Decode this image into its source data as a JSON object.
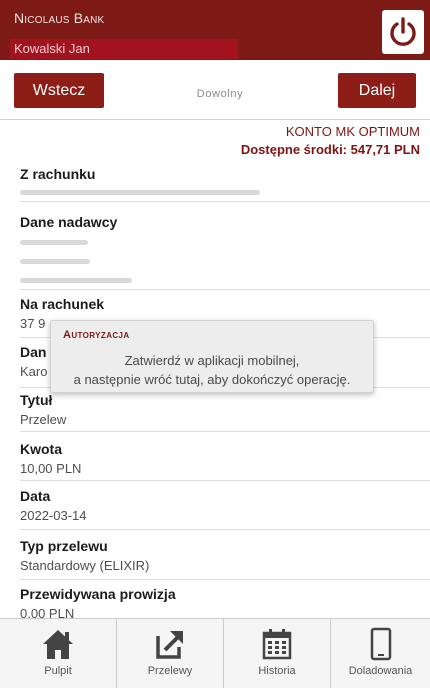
{
  "header": {
    "bank_name": "Nicolaus Bank",
    "user_name": "Kowalski Jan",
    "power_icon": "power-icon"
  },
  "nav": {
    "back_label": "Wstecz",
    "mode_title": "Dowolny",
    "next_label": "Dalej"
  },
  "account": {
    "name": "KONTO MK OPTIMUM",
    "balance": "Dostępne środki: 547,71 PLN"
  },
  "form": {
    "from_account_label": "Z rachunku",
    "sender_label": "Dane nadawcy",
    "to_account_label": "Na rachunek",
    "to_account_value": "37 9",
    "recipient_label": "Dan",
    "recipient_value": "Karo",
    "title_label": "Tytuł",
    "title_value": "Przelew",
    "amount_label": "Kwota",
    "amount_value": "10,00 PLN",
    "date_label": "Data",
    "date_value": "2022-03-14",
    "type_label": "Typ przelewu",
    "type_value": "Standardowy (ELIXIR)",
    "fee_label": "Przewidywana prowizja",
    "fee_value": "0,00 PLN"
  },
  "modal": {
    "title": "Autoryzacja",
    "line1": "Zatwierdź w aplikacji mobilnej,",
    "line2": "a następnie wróć tutaj, aby dokończyć operację."
  },
  "tabs": [
    {
      "label": "Pulpit",
      "icon": "home-icon"
    },
    {
      "label": "Przelewy",
      "icon": "transfer-icon"
    },
    {
      "label": "Historia",
      "icon": "calendar-icon"
    },
    {
      "label": "Doladowania",
      "icon": "phone-icon"
    }
  ],
  "colors": {
    "brand": "#7d1a16",
    "accent": "#a3131f",
    "button": "#8c1d17"
  }
}
